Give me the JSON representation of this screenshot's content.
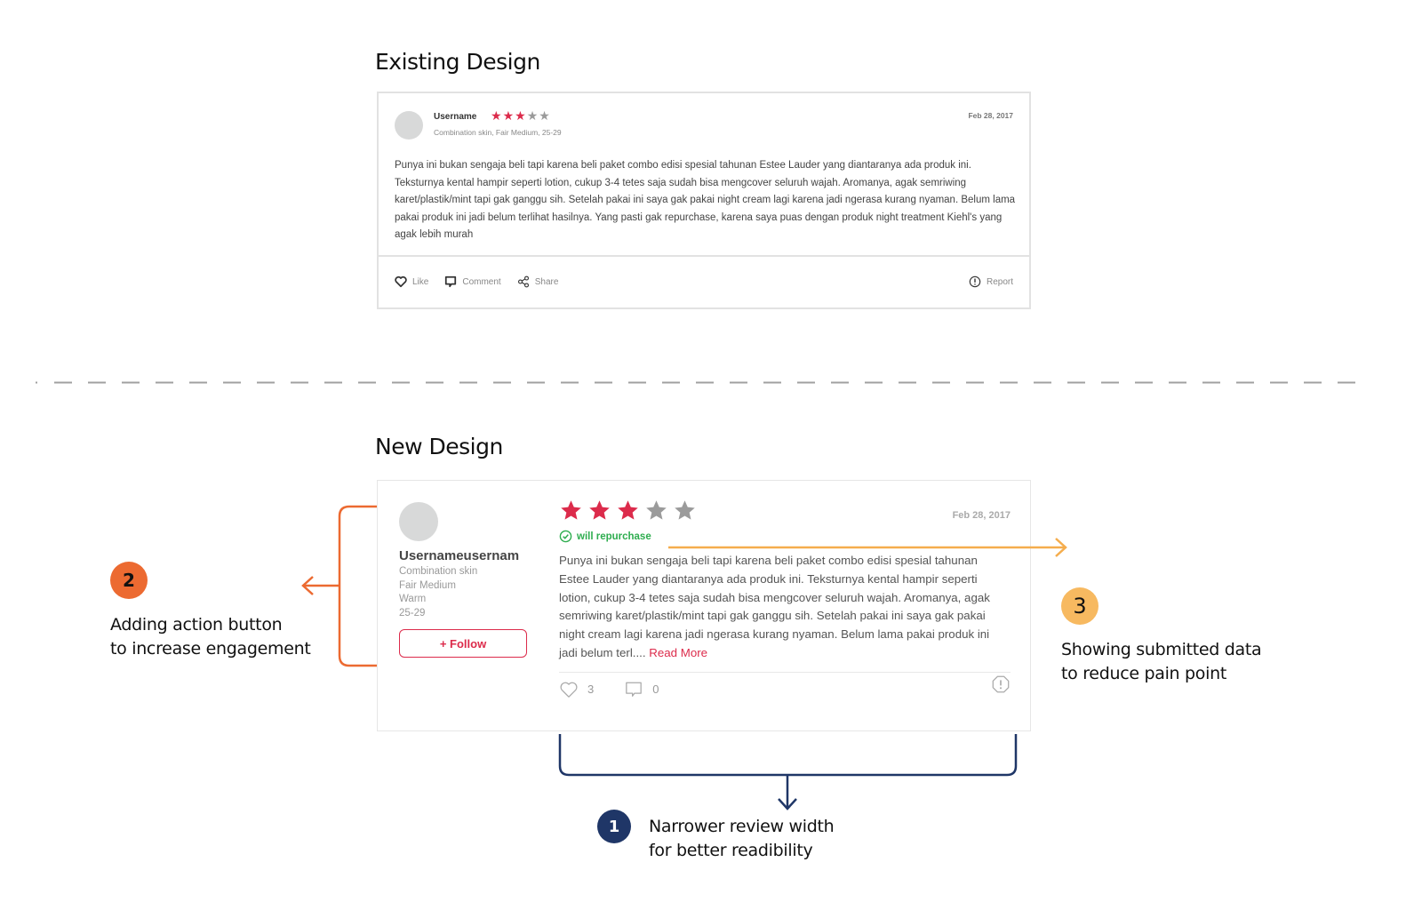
{
  "existing": {
    "title": "Existing Design",
    "review": {
      "username": "Username",
      "rating": 3,
      "max_rating": 5,
      "meta": "Combination skin, Fair Medium, 25-29",
      "date": "Feb 28, 2017",
      "body": "Punya ini bukan sengaja beli tapi karena beli paket combo edisi spesial tahunan Estee Lauder yang diantaranya ada produk ini. Teksturnya kental hampir seperti lotion, cukup 3-4 tetes saja sudah bisa mengcover seluruh wajah. Aromanya, agak semriwing karet/plastik/mint tapi gak ganggu sih. Setelah pakai ini saya gak pakai night cream lagi karena jadi ngerasa kurang nyaman. Belum lama pakai produk ini jadi belum terlihat hasilnya. Yang pasti gak repurchase, karena saya puas dengan produk night treatment Kiehl's yang agak lebih murah",
      "actions": {
        "like": "Like",
        "comment": "Comment",
        "share": "Share",
        "report": "Report"
      }
    }
  },
  "new": {
    "title": "New Design",
    "review": {
      "username": "Usernameusernam",
      "meta_lines": [
        "Combination skin",
        "Fair Medium",
        "Warm",
        "25-29"
      ],
      "follow_label": "+ Follow",
      "rating": 3,
      "max_rating": 5,
      "date": "Feb 28, 2017",
      "repurchase_label": "will repurchase",
      "body": "Punya ini bukan sengaja beli tapi karena beli paket combo edisi spesial tahunan Estee Lauder yang diantaranya ada produk ini. Teksturnya kental hampir seperti lotion, cukup 3-4 tetes saja sudah bisa mengcover seluruh wajah. Aromanya, agak semriwing karet/plastik/mint tapi gak ganggu sih. Setelah pakai ini saya gak pakai night cream lagi karena jadi ngerasa kurang nyaman. Belum lama pakai produk ini jadi belum terl....",
      "read_more": " Read More",
      "like_count": "3",
      "comment_count": "0"
    }
  },
  "annotations": [
    {
      "number": "1",
      "text_line1": "Narrower review width",
      "text_line2": "for better readibility",
      "color": "#1f3667"
    },
    {
      "number": "2",
      "text_line1": "Adding action button",
      "text_line2": "to increase engagement",
      "color": "#ec6a31"
    },
    {
      "number": "3",
      "text_line1": "Showing submitted data",
      "text_line2": "to reduce pain point",
      "color": "#f7b960"
    }
  ],
  "colors": {
    "star_active": "#dc2b4b",
    "star_inactive": "#9b9b9b",
    "repurchase_green": "#2ead4f",
    "separator": "#a0a0a0"
  }
}
